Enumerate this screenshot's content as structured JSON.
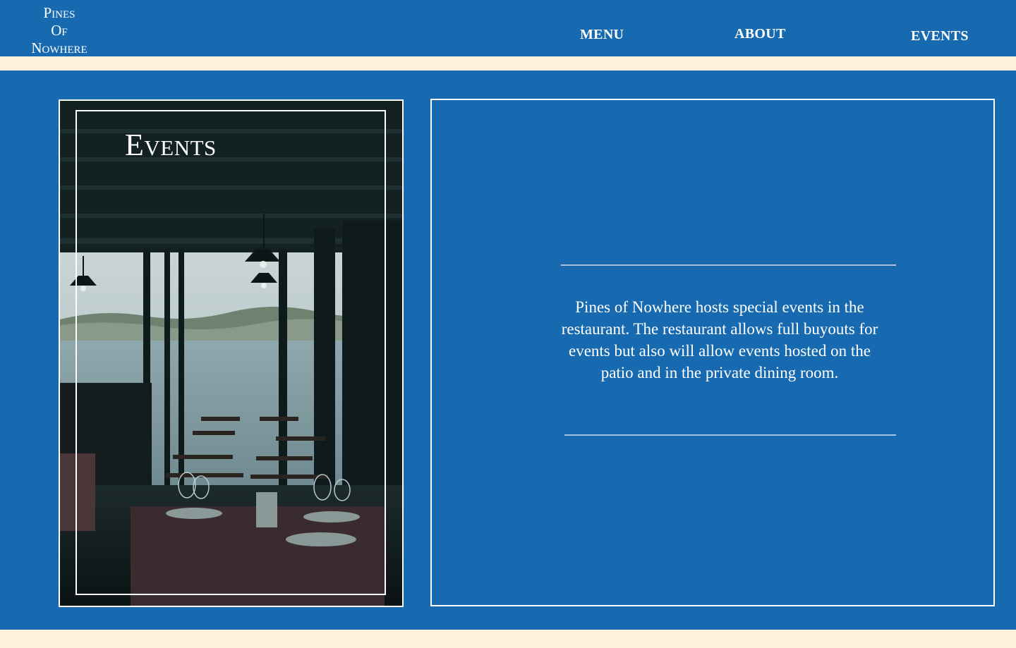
{
  "header": {
    "logo": {
      "line1": "Pines",
      "line2": "Of",
      "line3": "Nowhere"
    },
    "nav": {
      "menu": "MENU",
      "about": "ABOUT",
      "events": "EVENTS"
    }
  },
  "events_section": {
    "photo_title": "Events",
    "description": "Pines of Nowhere hosts special events in the restaurant. The restaurant allows full buyouts for events but also will allow events hosted on the patio and in the private dining room."
  },
  "colors": {
    "brand_blue": "#176aaf",
    "cream": "#fdf0dc",
    "white": "#ffffff"
  }
}
